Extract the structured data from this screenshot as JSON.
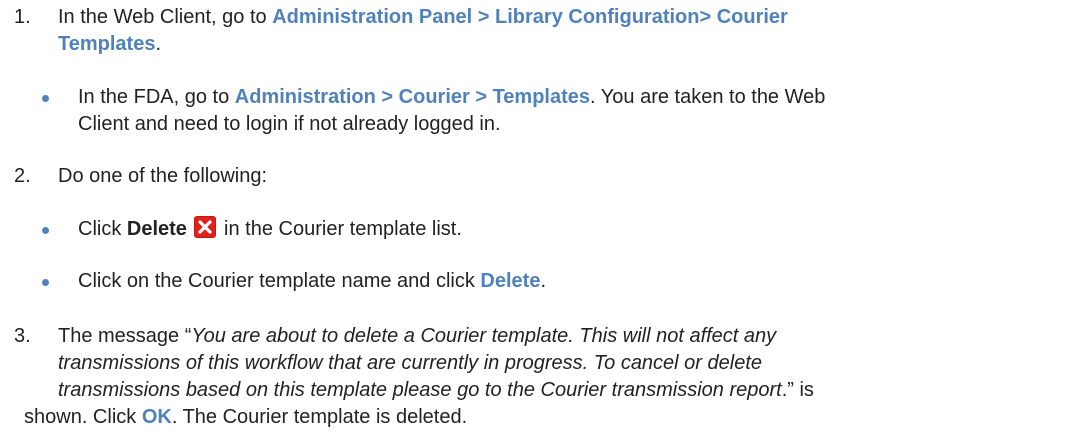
{
  "colors": {
    "link_blue": "#4f81bd",
    "bullet_blue": "#4f81bd",
    "delete_icon_red": "#e0201b",
    "text": "#222222"
  },
  "steps": [
    {
      "number": "1.",
      "line1_pre": "In the Web Client, go to ",
      "line1_bold": "Administration Panel > Library Configuration> Courier",
      "line2_bold": "Templates",
      "line2_post": ".",
      "bullets": [
        {
          "pre": "In the FDA, go to ",
          "bold": "Administration > Courier > Templates",
          "post": ". You are taken to the Web",
          "line2": "Client and need to login if not already logged in."
        }
      ]
    },
    {
      "number": "2.",
      "text": "Do one of the following:",
      "bullets": [
        {
          "pre": "Click ",
          "bold": "Delete",
          "icon": "delete-x-icon",
          "post": " in the Courier template list."
        },
        {
          "pre": "Click on the Courier template name and click ",
          "bold": "Delete",
          "post": "."
        }
      ]
    },
    {
      "number": "3.",
      "line1_pre": "The message “",
      "line1_italic": "You are about to delete a Courier template. This will not affect any",
      "line2_italic": "transmissions of this workflow that are currently in progress. To cancel or delete",
      "line3_italic": "transmissions based on this template please go to the Courier transmission report",
      "line3_post": ".” is",
      "line4_pre": "shown. Click ",
      "line4_bold": "OK",
      "line4_post": ". The Courier template is deleted."
    }
  ]
}
